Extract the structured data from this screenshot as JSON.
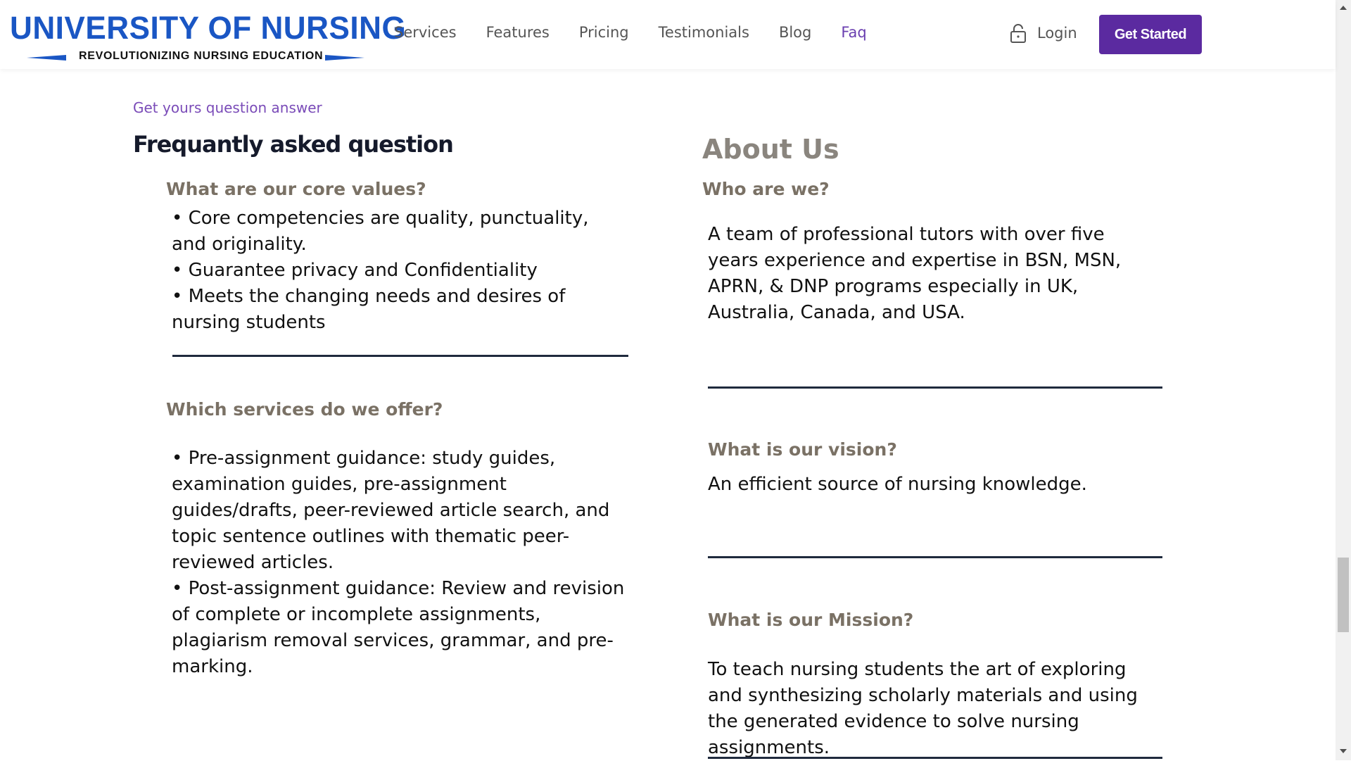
{
  "brand": {
    "title": "UNIVERSITY OF NURSING",
    "tagline": "REVOLUTIONIZING NURSING EDUCATION",
    "color": "#1a56c4"
  },
  "nav": {
    "items": [
      {
        "label": "Services"
      },
      {
        "label": "Features"
      },
      {
        "label": "Pricing"
      },
      {
        "label": "Testimonials"
      },
      {
        "label": "Blog"
      },
      {
        "label": "Faq",
        "active": true
      }
    ],
    "login_label": "Login",
    "login_icon": "lock-icon",
    "cta_label": "Get Started",
    "cta_color": "#5b2aa0",
    "active_color": "#6a3fb0"
  },
  "faq": {
    "eyebrow": "Get yours question answer",
    "title": "Frequantly asked question",
    "q1": {
      "heading": "What are our core values?",
      "lines": [
        "• Core competencies are quality, punctuality, and originality.",
        "• Guarantee privacy and Confidentiality",
        "• Meets the changing needs and desires of nursing students"
      ]
    },
    "q2": {
      "heading": "Which services do we offer?",
      "lines": [
        "• Pre-assignment guidance: study guides, examination guides, pre-assignment guides/drafts, peer-reviewed article search, and topic sentence outlines with thematic peer-reviewed articles.",
        "• Post-assignment guidance: Review and revision of complete or incomplete assignments, plagiarism removal services, grammar, and pre-marking."
      ]
    }
  },
  "about": {
    "title": "About Us",
    "who": {
      "heading": "Who are we?",
      "text": "A team of professional tutors with over five years experience and expertise in BSN, MSN, APRN, & DNP programs especially in UK, Australia, Canada, and USA."
    },
    "vision": {
      "heading": "What is our vision?",
      "text": "An efficient source of nursing knowledge."
    },
    "mission": {
      "heading": "What is our Mission?",
      "text": "To teach nursing students the art of exploring and synthesizing scholarly materials and using the generated evidence to solve nursing assignments."
    }
  }
}
